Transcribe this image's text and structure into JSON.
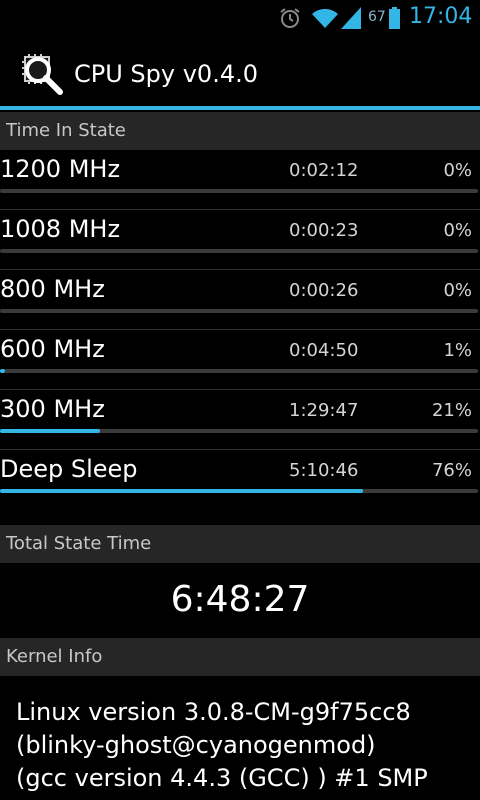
{
  "status_bar": {
    "battery_level": "67",
    "time": "17:04",
    "icons": [
      "alarm-icon",
      "wifi-icon",
      "signal-icon",
      "battery-icon"
    ]
  },
  "app": {
    "title": "CPU Spy v0.4.0",
    "icon": "cpu-magnifier-icon"
  },
  "colors": {
    "accent": "#33b5e5",
    "header_bg": "#262626",
    "track": "#3a3a3a"
  },
  "time_in_state": {
    "header": "Time In State",
    "states": [
      {
        "name": "1200 MHz",
        "time": "0:02:12",
        "percent": "0%",
        "fraction": 0.0
      },
      {
        "name": "1008 MHz",
        "time": "0:00:23",
        "percent": "0%",
        "fraction": 0.0
      },
      {
        "name": "800 MHz",
        "time": "0:00:26",
        "percent": "0%",
        "fraction": 0.0
      },
      {
        "name": "600 MHz",
        "time": "0:04:50",
        "percent": "1%",
        "fraction": 0.01
      },
      {
        "name": "300 MHz",
        "time": "1:29:47",
        "percent": "21%",
        "fraction": 0.21
      },
      {
        "name": "Deep Sleep",
        "time": "5:10:46",
        "percent": "76%",
        "fraction": 0.76
      }
    ]
  },
  "total_state_time": {
    "header": "Total State Time",
    "value": "6:48:27"
  },
  "kernel_info": {
    "header": "Kernel Info",
    "lines": [
      "Linux version 3.0.8-CM-g9f75cc8",
      "(blinky-ghost@cyanogenmod)",
      "(gcc version 4.4.3 (GCC) ) #1 SMP"
    ]
  }
}
